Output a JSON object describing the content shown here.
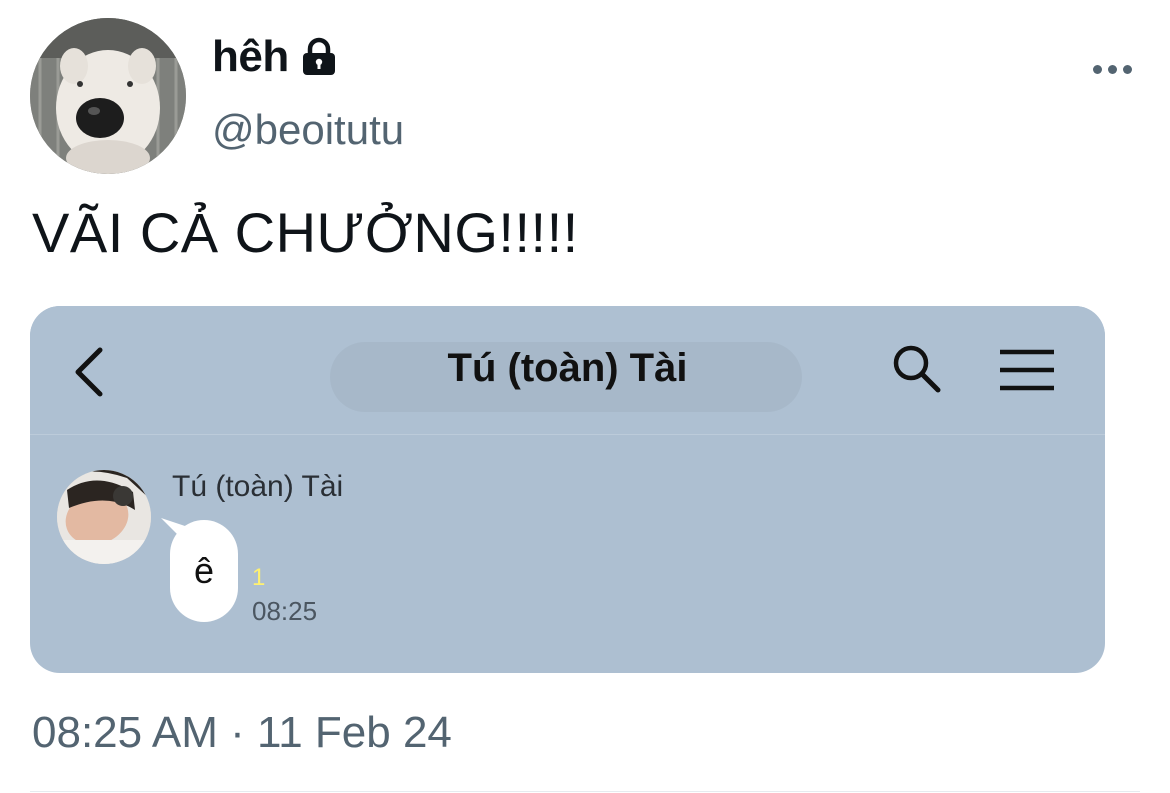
{
  "tweet": {
    "display_name": "hêh",
    "handle": "@beoitutu",
    "text": "VÃI CẢ CHƯỞNG!!!!!",
    "timestamp": "08:25 AM · 11 Feb 24",
    "icons": [
      "lock-icon",
      "more-icon"
    ]
  },
  "screenshot": {
    "chat_title": "Tú (toàn) Tài",
    "header_icons": [
      "back-icon",
      "search-icon",
      "menu-icon"
    ],
    "message": {
      "sender": "Tú (toàn) Tài",
      "text": "ê",
      "read_count": "1",
      "time": "08:25"
    },
    "colors": {
      "background": "#adbfd1",
      "bubble": "#ffffff",
      "read_count": "#fff170"
    }
  }
}
